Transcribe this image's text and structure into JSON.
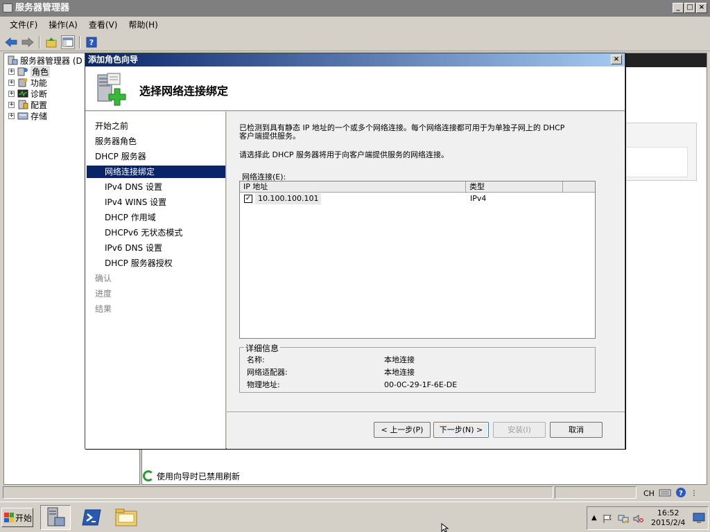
{
  "main_window": {
    "title": "服务器管理器",
    "controls": [
      "_",
      "□",
      "×"
    ]
  },
  "menubar": {
    "items": [
      "文件(F)",
      "操作(A)",
      "查看(V)",
      "帮助(H)"
    ]
  },
  "toolbar": {
    "buttons": [
      "back-icon",
      "forward-icon",
      "up-icon",
      "show-hide-icon",
      "help-icon"
    ]
  },
  "tree": {
    "root": "服务器管理器 (D",
    "items": [
      "角色",
      "功能",
      "诊断",
      "配置",
      "存储"
    ]
  },
  "content": {
    "refresh_message": "使用向导时已禁用刷新"
  },
  "dialog": {
    "title": "添加角色向导",
    "close": "×",
    "banner_title": "选择网络连接绑定",
    "nav": [
      {
        "label": "开始之前",
        "level": 0,
        "state": "normal"
      },
      {
        "label": "服务器角色",
        "level": 0,
        "state": "normal"
      },
      {
        "label": "DHCP 服务器",
        "level": 0,
        "state": "normal"
      },
      {
        "label": "网络连接绑定",
        "level": 1,
        "state": "active"
      },
      {
        "label": "IPv4 DNS 设置",
        "level": 1,
        "state": "normal"
      },
      {
        "label": "IPv4 WINS 设置",
        "level": 1,
        "state": "normal"
      },
      {
        "label": "DHCP 作用域",
        "level": 1,
        "state": "normal"
      },
      {
        "label": "DHCPv6 无状态模式",
        "level": 1,
        "state": "normal"
      },
      {
        "label": "IPv6 DNS 设置",
        "level": 1,
        "state": "normal"
      },
      {
        "label": "DHCP 服务器授权",
        "level": 1,
        "state": "normal"
      },
      {
        "label": "确认",
        "level": 0,
        "state": "disabled"
      },
      {
        "label": "进度",
        "level": 0,
        "state": "disabled"
      },
      {
        "label": "结果",
        "level": 0,
        "state": "disabled"
      }
    ],
    "intro_line1": "已检测到具有静态 IP 地址的一个或多个网络连接。每个网络连接都可用于为单独子网上的 DHCP",
    "intro_line1b": "客户端提供服务。",
    "intro_line2": "请选择此 DHCP 服务器将用于向客户端提供服务的网络连接。",
    "connections_label": "网络连接(E):",
    "columns": [
      "IP 地址",
      "类型"
    ],
    "rows": [
      {
        "checked": true,
        "ip": "10.100.100.101",
        "type": "IPv4"
      }
    ],
    "details": {
      "legend": "详细信息",
      "rows": [
        {
          "label": "名称:",
          "value": "本地连接"
        },
        {
          "label": "网络适配器:",
          "value": "本地连接"
        },
        {
          "label": "物理地址:",
          "value": "00-0C-29-1F-6E-DE"
        }
      ]
    },
    "buttons": {
      "prev": "< 上一步(P)",
      "next": "下一步(N) >",
      "install": "安装(I)",
      "cancel": "取消"
    }
  },
  "statusbar": {
    "lang": "CH"
  },
  "taskbar": {
    "start_label": "开始",
    "clock_time": "16:52",
    "clock_date": "2015/2/4"
  }
}
